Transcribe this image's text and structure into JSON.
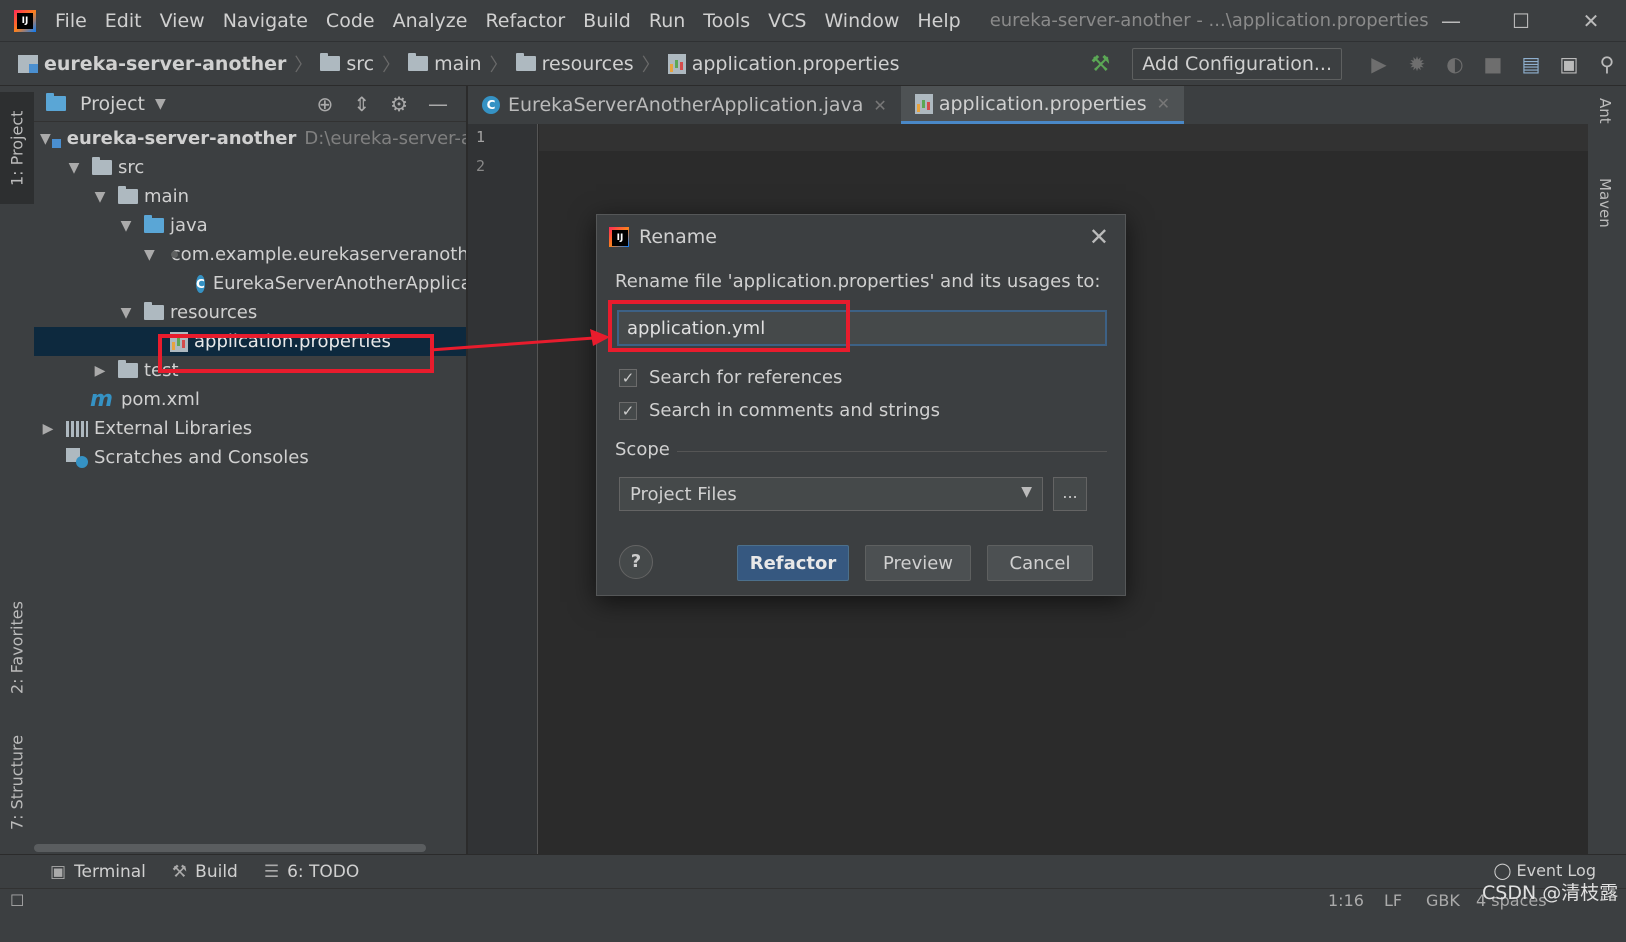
{
  "menubar": {
    "items": [
      "File",
      "Edit",
      "View",
      "Navigate",
      "Code",
      "Analyze",
      "Refactor",
      "Build",
      "Run",
      "Tools",
      "VCS",
      "Window",
      "Help"
    ],
    "window_title": "eureka-server-another - ...\\application.properties",
    "minimize": "—",
    "maximize": "☐",
    "close": "✕"
  },
  "navbar": {
    "crumbs": [
      "eureka-server-another",
      "src",
      "main",
      "resources",
      "application.properties"
    ],
    "add_configuration": "Add Configuration..."
  },
  "left_strip": {
    "project_tab": "1: Project",
    "favorites_tab": "2: Favorites",
    "structure_tab": "7: Structure"
  },
  "project_panel": {
    "title": "Project",
    "tree": {
      "root_name": "eureka-server-another",
      "root_path": "D:\\eureka-server-anc",
      "src": "src",
      "main": "main",
      "java": "java",
      "package": "com.example.eurekaserveranothe",
      "class": "EurekaServerAnotherApplicat",
      "resources": "resources",
      "props_file": "application.properties",
      "test": "test",
      "pom": "pom.xml",
      "external_libs": "External Libraries",
      "scratches": "Scratches and Consoles"
    }
  },
  "editor": {
    "tabs": [
      "EurekaServerAnotherApplication.java",
      "application.properties"
    ],
    "line_numbers": [
      "1",
      "2"
    ]
  },
  "right_strip": {
    "ant": "Ant",
    "maven": "Maven"
  },
  "dialog": {
    "title": "Rename",
    "label": "Rename file 'application.properties' and its usages to:",
    "input_value": "application.yml",
    "check_references": "Search for references",
    "check_comments": "Search in comments and strings",
    "scope_label": "Scope",
    "scope_value": "Project Files",
    "more": "...",
    "help": "?",
    "refactor": "Refactor",
    "preview": "Preview",
    "cancel": "Cancel"
  },
  "bottom_tools": {
    "terminal": "Terminal",
    "build": "Build",
    "todo": "6: TODO",
    "event_log": "Event Log"
  },
  "statusbar": {
    "position": "1:16",
    "line_sep": "LF",
    "encoding": "GBK",
    "indent": "4 spaces"
  },
  "watermark": "CSDN @清枝露",
  "colors": {
    "annotation_red": "#e81c2d",
    "selection": "#0d293e",
    "primary_button": "#365880"
  }
}
